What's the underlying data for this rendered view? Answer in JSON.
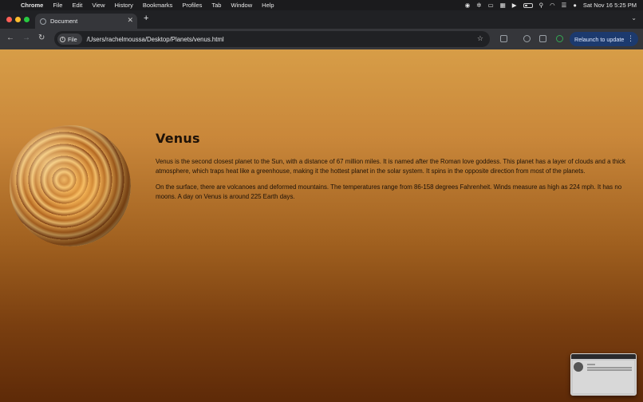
{
  "menubar": {
    "app": "Chrome",
    "items": [
      "File",
      "Edit",
      "View",
      "History",
      "Bookmarks",
      "Profiles",
      "Tab",
      "Window",
      "Help"
    ],
    "datetime": "Sat Nov 16  5:25 PM"
  },
  "browser": {
    "tab_title": "Document",
    "site_chip": "File",
    "url": "/Users/rachelmoussa/Desktop/Planets/venus.html",
    "relaunch_label": "Relaunch to update"
  },
  "page": {
    "title": "Venus",
    "paragraphs": [
      "Venus is the second closest planet to the Sun, with a distance of 67 million miles. It is named after the Roman love goddess. This planet has a layer of clouds and a thick atmosphere, which traps heat like a greenhouse, making it the hottest planet in the solar system. It spins in the opposite direction from most of the planets.",
      "On the surface, there are volcanoes and deformed mountains. The temperatures range from 86-158 degrees Fahrenheit. Winds measure as high as 224 mph. It has no moons. A day on Venus is around 225 Earth days."
    ]
  },
  "colors": {
    "accent": "#1c3a6e",
    "page_top": "#d79d47",
    "page_bottom": "#5e2a08"
  }
}
